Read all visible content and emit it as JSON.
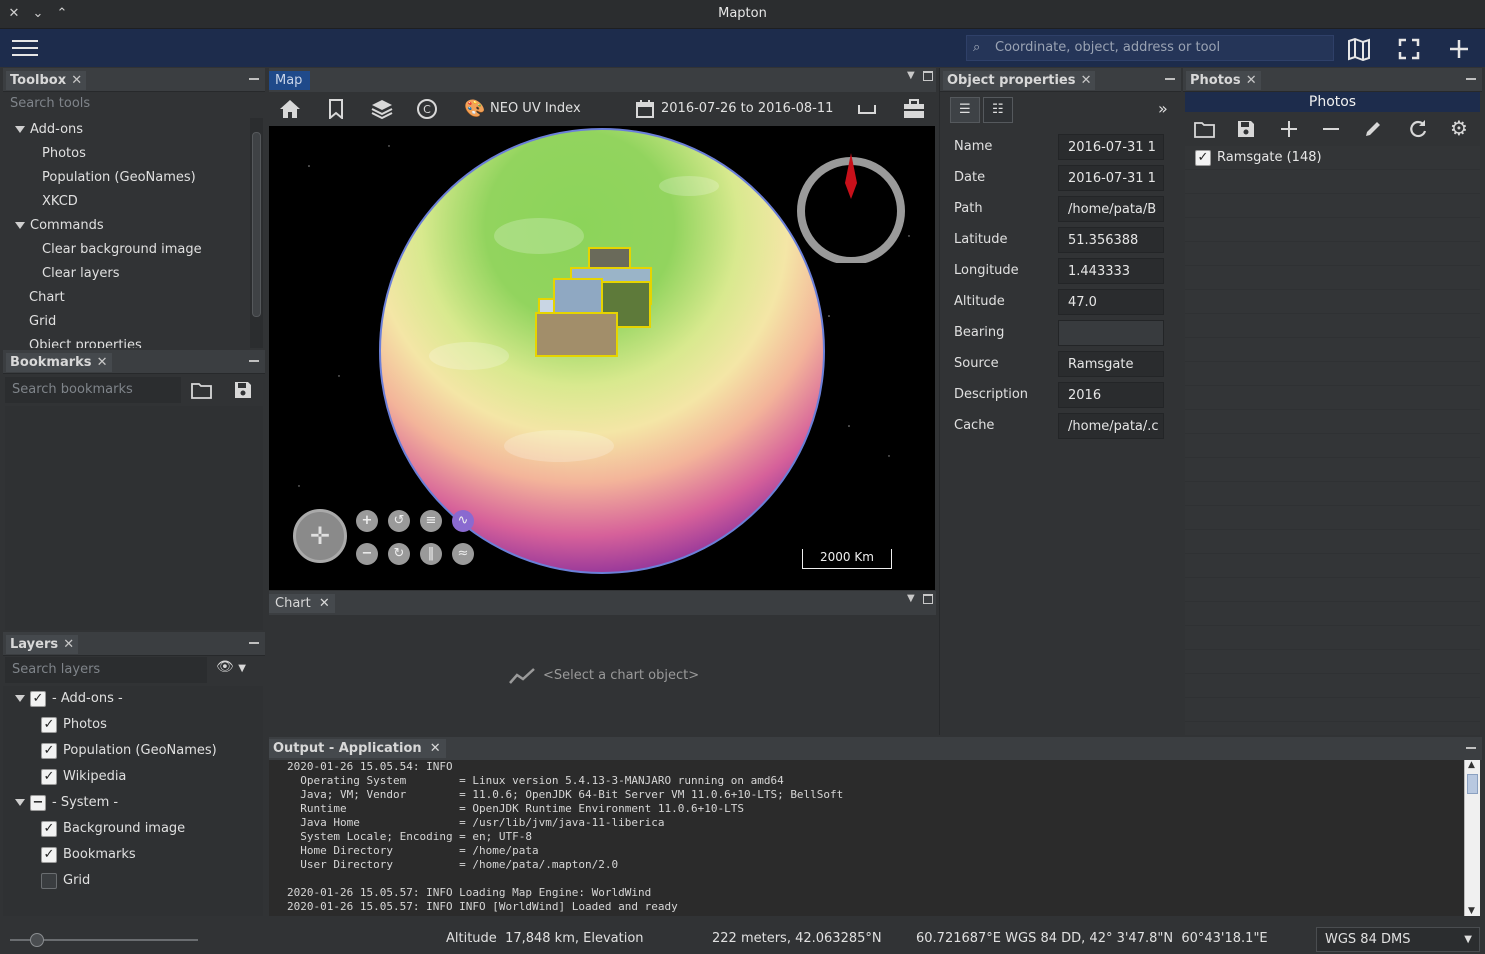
{
  "window": {
    "title": "Mapton"
  },
  "topbar": {
    "search_placeholder": "Coordinate, object, address or tool"
  },
  "toolbox": {
    "title": "Toolbox",
    "search_placeholder": "Search tools",
    "items": [
      {
        "label": "Add-ons",
        "level": 0,
        "expanded": true
      },
      {
        "label": "Photos",
        "level": 1
      },
      {
        "label": "Population (GeoNames)",
        "level": 1
      },
      {
        "label": "XKCD",
        "level": 1
      },
      {
        "label": "Commands",
        "level": 0,
        "expanded": true
      },
      {
        "label": "Clear background image",
        "level": 1
      },
      {
        "label": "Clear layers",
        "level": 1
      },
      {
        "label": "Chart",
        "level": 0
      },
      {
        "label": "Grid",
        "level": 0
      },
      {
        "label": "Object properties",
        "level": 0
      }
    ]
  },
  "bookmarks": {
    "title": "Bookmarks",
    "search_placeholder": "Search bookmarks"
  },
  "layers": {
    "title": "Layers",
    "search_placeholder": "Search layers",
    "items": [
      {
        "label": "- Add-ons -",
        "level": 0,
        "state": "checked"
      },
      {
        "label": "Photos",
        "level": 1,
        "state": "checked"
      },
      {
        "label": "Population (GeoNames)",
        "level": 1,
        "state": "checked"
      },
      {
        "label": "Wikipedia",
        "level": 1,
        "state": "checked"
      },
      {
        "label": "- System -",
        "level": 0,
        "state": "partial"
      },
      {
        "label": "Background image",
        "level": 1,
        "state": "checked"
      },
      {
        "label": "Bookmarks",
        "level": 1,
        "state": "checked"
      },
      {
        "label": "Grid",
        "level": 1,
        "state": "unchecked"
      }
    ]
  },
  "map": {
    "tab": "Map",
    "layer_name": "NEO UV Index",
    "date_range": "2016-07-26 to 2016-08-11",
    "scale_label": "2000 Km"
  },
  "chart": {
    "tab": "Chart",
    "placeholder": "<Select a chart object>"
  },
  "object_properties": {
    "title": "Object properties",
    "rows": [
      {
        "label": "Name",
        "value": "2016-07-31 1"
      },
      {
        "label": "Date",
        "value": "2016-07-31 1"
      },
      {
        "label": "Path",
        "value": "/home/pata/B"
      },
      {
        "label": "Latitude",
        "value": "51.356388"
      },
      {
        "label": "Longitude",
        "value": "1.443333"
      },
      {
        "label": "Altitude",
        "value": "47.0"
      },
      {
        "label": "Bearing",
        "value": ""
      },
      {
        "label": "Source",
        "value": "Ramsgate"
      },
      {
        "label": "Description",
        "value": "2016"
      },
      {
        "label": "Cache",
        "value": "/home/pata/.c"
      }
    ]
  },
  "photos": {
    "title": "Photos",
    "header": "Photos",
    "items": [
      {
        "label": "Ramsgate (148)",
        "checked": true
      }
    ]
  },
  "output": {
    "title": "Output - Application",
    "lines": [
      "2020-01-26 15.05.54: INFO",
      "  Operating System        = Linux version 5.4.13-3-MANJARO running on amd64",
      "  Java; VM; Vendor        = 11.0.6; OpenJDK 64-Bit Server VM 11.0.6+10-LTS; BellSoft",
      "  Runtime                 = OpenJDK Runtime Environment 11.0.6+10-LTS",
      "  Java Home               = /usr/lib/jvm/java-11-liberica",
      "  System Locale; Encoding = en; UTF-8",
      "  Home Directory          = /home/pata",
      "  User Directory          = /home/pata/.mapton/2.0",
      "",
      "2020-01-26 15.05.57: INFO Loading Map Engine: WorldWind",
      "2020-01-26 15.05.57: INFO INFO [WorldWind] Loaded and ready"
    ]
  },
  "status": {
    "altitude": "Altitude  17,848 km, Elevation",
    "elevation": "222 meters, 42.063285°N",
    "coords": "60.721687°E WGS 84 DD, 42° 3'47.8\"N  60°43'18.1\"E",
    "crs": "WGS 84 DMS"
  }
}
